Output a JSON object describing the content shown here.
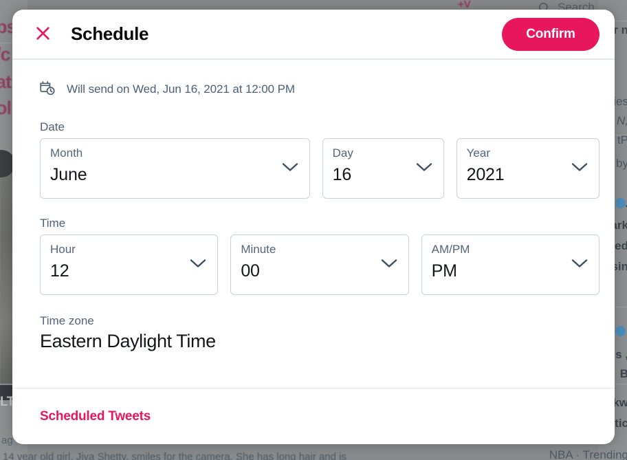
{
  "modal": {
    "title": "Schedule",
    "close_icon": "close-icon",
    "confirm_label": "Confirm",
    "summary": {
      "icon": "calendar-clock-icon",
      "text": "Will send on Wed, Jun 16, 2021 at 12:00 PM"
    },
    "date_section": {
      "label": "Date",
      "fields": [
        {
          "label": "Month",
          "value": "June"
        },
        {
          "label": "Day",
          "value": "16"
        },
        {
          "label": "Year",
          "value": "2021"
        }
      ]
    },
    "time_section": {
      "label": "Time",
      "fields": [
        {
          "label": "Hour",
          "value": "12"
        },
        {
          "label": "Minute",
          "value": "00"
        },
        {
          "label": "AM/PM",
          "value": "PM"
        }
      ]
    },
    "timezone": {
      "label": "Time zone",
      "value": "Eastern Daylight Time"
    },
    "footer": {
      "link_label": "Scheduled Tweets"
    }
  },
  "colors": {
    "accent": "#e8175d",
    "label_text": "#4c6077",
    "value_text": "#14161a",
    "field_border": "#c9d3dc",
    "divider": "#e3e8ec"
  },
  "background": {
    "search_label": "Search",
    "search_icon": "search-icon",
    "compose_badge": "+V",
    "left_fragments": [
      "ps:",
      "/c",
      "at",
      "ol",
      "LT",
      "ag",
      "14  year  old girl,  Jiya Shetty,  smiles for the camera.  She has long hair and is"
    ],
    "right_fragments": [
      "r n",
      "ies",
      "N,",
      "tP",
      "by",
      ".",
      "ark",
      "ed",
      "sin",
      "'s ,",
      "B",
      "kw",
      "atic",
      "NBA · Trending"
    ]
  }
}
